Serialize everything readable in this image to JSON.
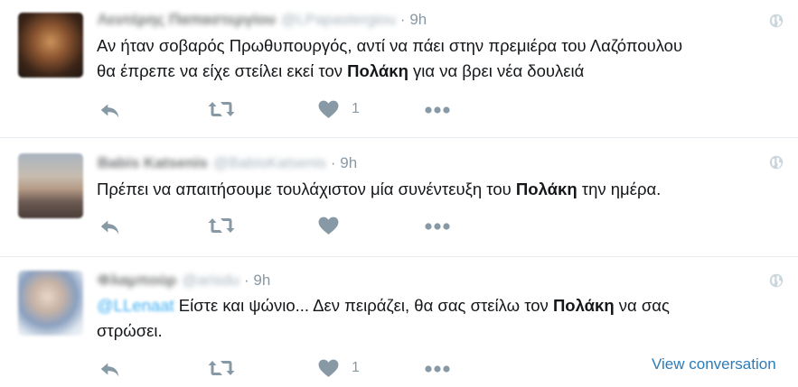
{
  "tweets": [
    {
      "name": "Λευτέρης Παπαστεργίου",
      "handle": "@LPapastergiou",
      "time": "9h",
      "text_line1": "Αν ήταν σοβαρός Πρωθυπουργός, αντί να πάει στην πρεμιέρα του Λαζόπουλου",
      "text_line2_pre": "θα έπρεπε να είχε στείλει εκεί τον ",
      "text_bold": "Πολάκη",
      "text_line2_post": " για να βρει νέα δουλειά",
      "like_count": "1"
    },
    {
      "name": "Babis Katsenis",
      "handle": "@BabisKatsenis",
      "time": "9h",
      "text_pre": "Πρέπει να απαιτήσουμε τουλάχιστον μία συνέντευξη του ",
      "text_bold": "Πολάκη",
      "text_post": " την ημέρα."
    },
    {
      "name": "Φλαμπούρ",
      "handle": "@arisdu",
      "time": "9h",
      "mention": "@LLenaat",
      "text_pre": " Είστε και ψώνιο... Δεν πειράζει, θα σας στείλω τον ",
      "text_bold": "Πολάκη",
      "text_post": " να σας",
      "text_line2": "στρώσει.",
      "like_count": "1",
      "view_conversation": "View conversation"
    }
  ],
  "separator": "·",
  "icons": [
    "reply-icon",
    "retweet-icon",
    "heart-icon",
    "more-icon",
    "globe-icon"
  ],
  "colors": {
    "icon": "#8899a6",
    "link": "#2b7bb9",
    "mention": "#1da1f2",
    "divider": "#e6ecf0"
  }
}
